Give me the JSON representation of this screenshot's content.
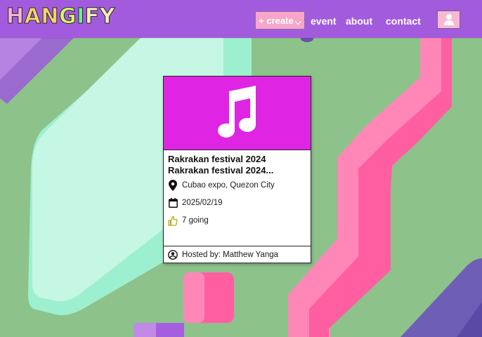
{
  "header": {
    "logo_letters": [
      {
        "char": "H",
        "color": "#f7b4cf"
      },
      {
        "char": "A",
        "color": "#f3d36d"
      },
      {
        "char": "N",
        "color": "#f3d36d"
      },
      {
        "char": "G",
        "color": "#d7f36a"
      },
      {
        "char": "I",
        "color": "#6ef08a"
      },
      {
        "char": "F",
        "color": "#f2efb8"
      },
      {
        "char": "Y",
        "color": "#f2efb8"
      }
    ],
    "create_label": "+ create",
    "create_caret": "⌵",
    "nav": {
      "event": "event",
      "about": "about",
      "contact": "contact"
    },
    "profile_icon": "user-icon"
  },
  "event_card": {
    "banner_color": "#e024e4",
    "banner_icon": "music-note-icon",
    "title_line1": "Rakrakan festival 2024",
    "title_line2": "Rakrakan festival 2024...",
    "location": "Cubao expo, Quezon City",
    "date": "2025/02/19",
    "going": "7 going",
    "host": "Hosted by: Matthew Yanga"
  },
  "colors": {
    "navbar": "#a35bdd",
    "background": "#8dc28b",
    "accent_pink": "#ff5fa0",
    "mint": "#c6f5e1",
    "like_icon": "#b9a81a"
  }
}
